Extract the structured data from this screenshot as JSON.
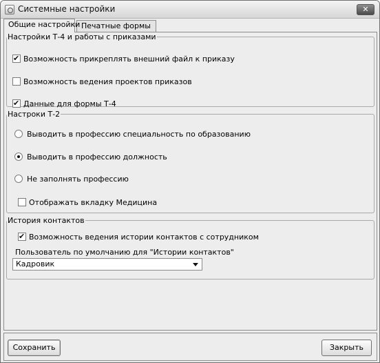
{
  "window": {
    "title": "Системные настройки"
  },
  "tabs": [
    {
      "label": "Общие настройки"
    },
    {
      "label": "Печатные формы"
    }
  ],
  "group_t4": {
    "legend": "Настройки Т-4 и работы с приказами",
    "items": [
      {
        "label": "Возможность прикреплять внешний файл к приказу",
        "checked": true
      },
      {
        "label": "Возможность ведения проектов приказов",
        "checked": false
      },
      {
        "label": "Данные для формы Т-4",
        "checked": true
      }
    ]
  },
  "group_t2": {
    "legend": "Настроки Т-2",
    "radios": [
      {
        "label": "Выводить в профессию специальность по образованию",
        "selected": false
      },
      {
        "label": "Выводить в профессию должность",
        "selected": true
      },
      {
        "label": "Не заполнять профессию",
        "selected": false
      }
    ],
    "medicine_tab": {
      "label": "Отображать вкладку Медицина",
      "checked": false
    }
  },
  "group_contacts": {
    "legend": "История контактов",
    "history": {
      "label": "Возможность ведения истории контактов с сотрудником",
      "checked": true
    },
    "default_user_label": "Пользователь по умолчанию для \"Истории контактов\"",
    "default_user_value": "Кадровик"
  },
  "buttons": {
    "save": "Сохранить",
    "close": "Закрыть"
  }
}
